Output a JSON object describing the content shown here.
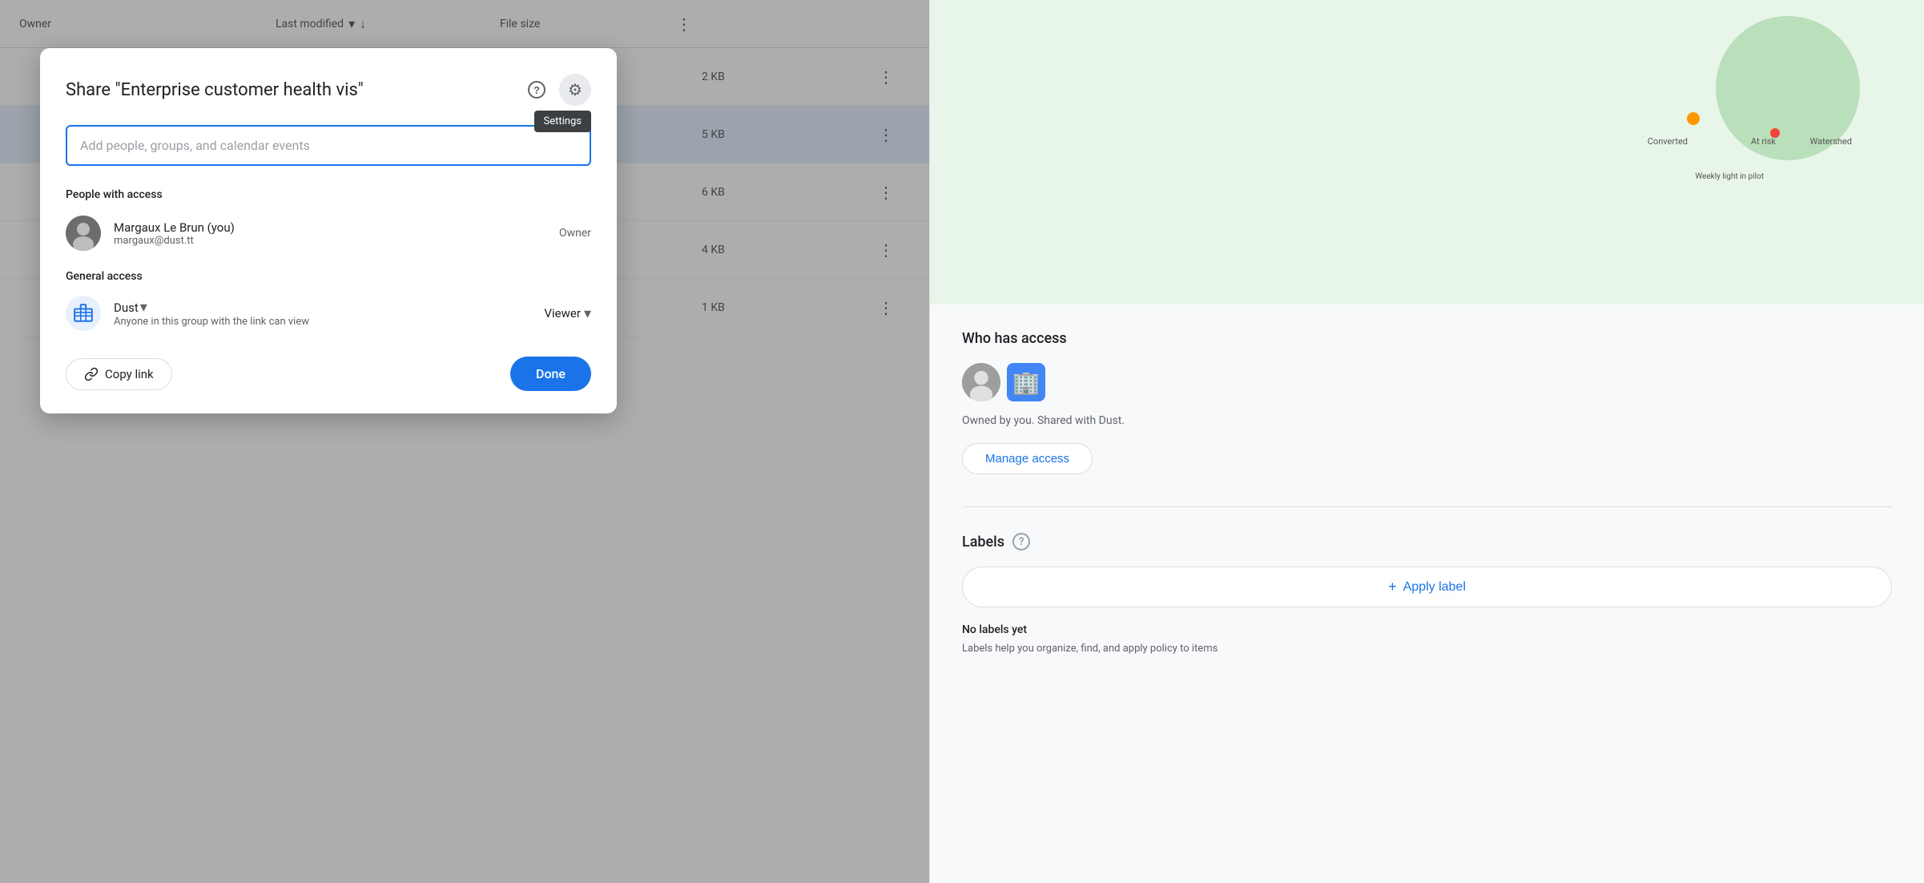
{
  "background": {
    "header": {
      "owner_label": "Owner",
      "modified_label": "Last modified",
      "filesize_label": "File size"
    },
    "rows": [
      {
        "filesize": "2 KB"
      },
      {
        "filesize": "5 KB",
        "highlighted": true
      },
      {
        "filesize": "6 KB"
      },
      {
        "filesize": "4 KB"
      },
      {
        "filesize": "1 KB"
      }
    ]
  },
  "right_panel": {
    "who_has_access": {
      "title": "Who has access",
      "description": "Owned by you. Shared with Dust.",
      "manage_access_label": "Manage access"
    },
    "labels": {
      "title": "Labels",
      "apply_label": "+ Apply label",
      "no_labels": "No labels yet",
      "help_text": "Labels help you organize, find, and apply policy to items"
    }
  },
  "modal": {
    "title": "Share \"Enterprise customer health vis\"",
    "help_icon": "?",
    "settings_icon": "⚙",
    "settings_tooltip": "Settings",
    "search_placeholder": "Add people, groups, and calendar events",
    "people_with_access_title": "People with access",
    "person": {
      "name": "Margaux Le Brun (you)",
      "email": "margaux@dust.tt",
      "role": "Owner"
    },
    "general_access_title": "General access",
    "general_access": {
      "name": "Dust",
      "description": "Anyone in this group with the link can view",
      "role": "Viewer"
    },
    "copy_link_label": "Copy link",
    "done_label": "Done"
  }
}
